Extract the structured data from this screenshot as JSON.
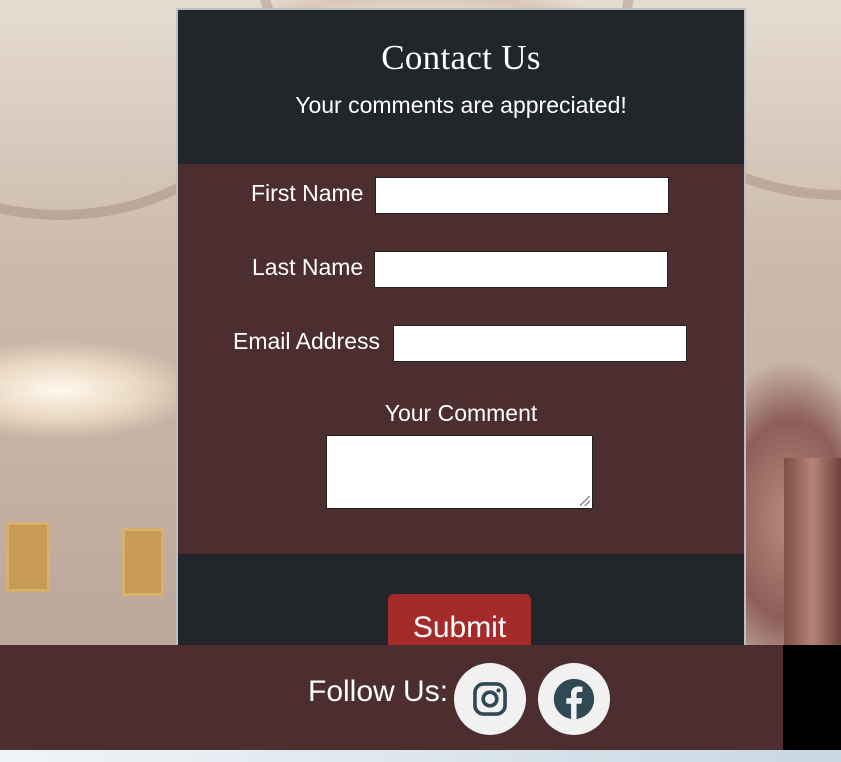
{
  "header": {
    "title": "Contact Us",
    "subtitle": "Your comments are appreciated!"
  },
  "form": {
    "first_name_label": "First Name",
    "first_name_value": "",
    "last_name_label": "Last Name",
    "last_name_value": "",
    "email_label": "Email Address",
    "email_value": "",
    "comment_label": "Your Comment",
    "comment_value": "",
    "submit_label": "Submit"
  },
  "footer": {
    "follow_label": "Follow Us:",
    "icons": [
      "instagram-icon",
      "facebook-icon"
    ]
  },
  "colors": {
    "card_dark": "#22262b",
    "form_maroon": "#4d2e30",
    "submit_red": "#a52a2a",
    "social_icon": "#2f4a55"
  }
}
